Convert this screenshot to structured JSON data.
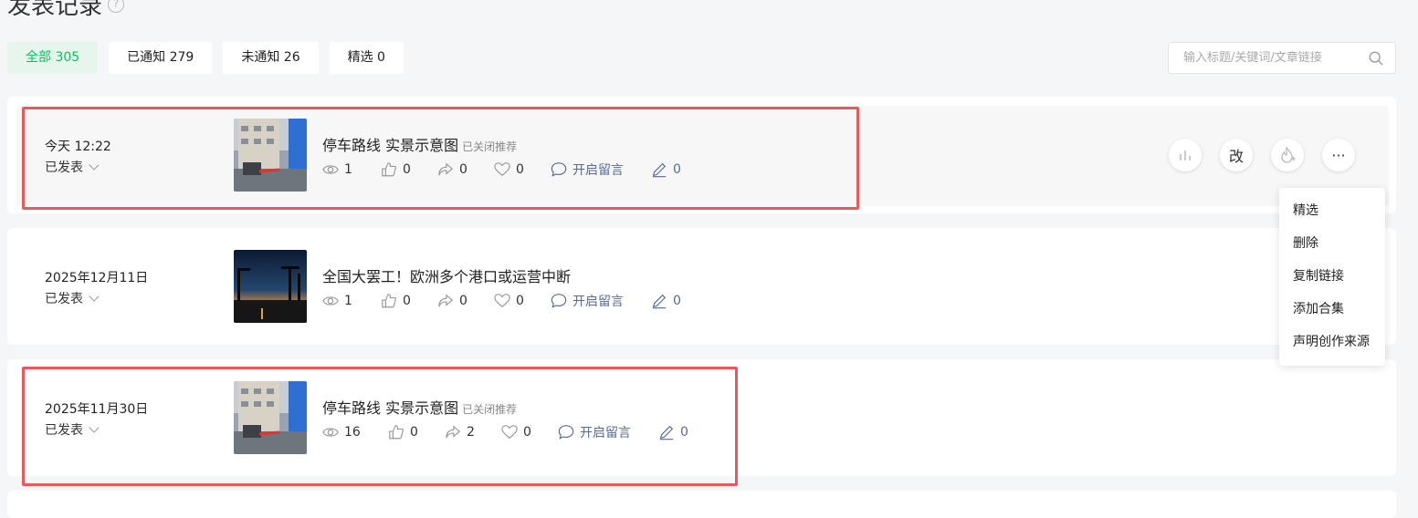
{
  "page": {
    "title": "发表记录"
  },
  "tabs": [
    {
      "label": "全部 305"
    },
    {
      "label": "已通知 279"
    },
    {
      "label": "未通知 26"
    },
    {
      "label": "精选 0"
    }
  ],
  "search": {
    "placeholder": "输入标题/关键词/文章链接"
  },
  "posts": [
    {
      "date": "今天 12:22",
      "status": "已发表",
      "title": "停车路线 实景示意图",
      "tag": "已关闭推荐",
      "views": "1",
      "likes": "0",
      "shares": "0",
      "hearts": "0",
      "comment": "开启留言",
      "edits": "0"
    },
    {
      "date": "2025年12月11日",
      "status": "已发表",
      "title": "全国大罢工！欧洲多个港口或运营中断",
      "tag": "",
      "views": "1",
      "likes": "0",
      "shares": "0",
      "hearts": "0",
      "comment": "开启留言",
      "edits": "0"
    },
    {
      "date": "2025年11月30日",
      "status": "已发表",
      "title": "停车路线 实景示意图",
      "tag": "已关闭推荐",
      "views": "16",
      "likes": "0",
      "shares": "2",
      "hearts": "0",
      "comment": "开启留言",
      "edits": "0"
    }
  ],
  "actions": {
    "edit_label": "改",
    "more_label": "···"
  },
  "menu": {
    "items": [
      {
        "label": "精选"
      },
      {
        "label": "删除"
      },
      {
        "label": "复制链接"
      },
      {
        "label": "添加合集"
      },
      {
        "label": "声明创作来源"
      }
    ]
  },
  "colors": {
    "accent": "#07c160",
    "link": "#576b95",
    "highlight": "#e8585c"
  }
}
